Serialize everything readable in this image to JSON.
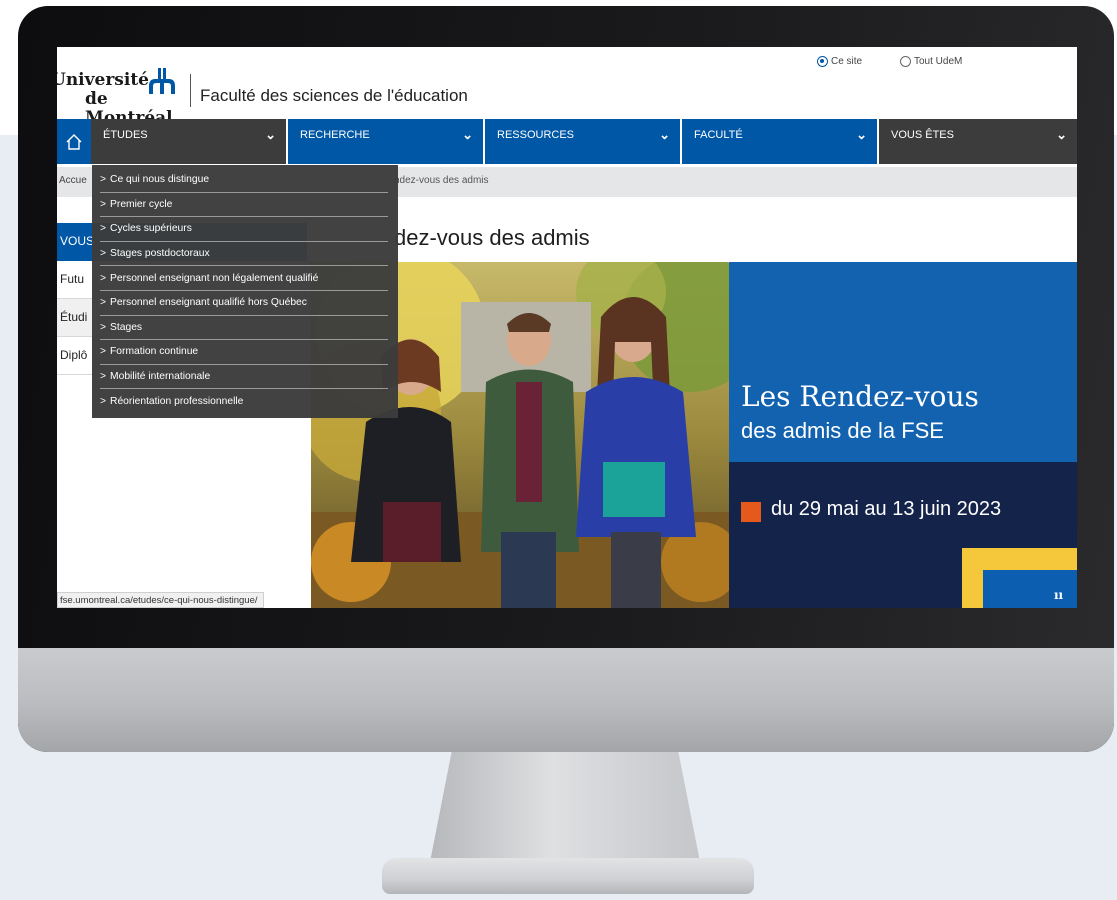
{
  "header": {
    "logo_line1": "Université",
    "logo_line2": "de Montréal",
    "faculty": "Faculté des sciences de l'éducation",
    "scope": {
      "site_label": "Ce site",
      "all_label": "Tout UdeM",
      "selected": "Ce site"
    }
  },
  "nav": {
    "items": [
      {
        "label": "ÉTUDES"
      },
      {
        "label": "RECHERCHE"
      },
      {
        "label": "RESSOURCES"
      },
      {
        "label": "FACULTÉ"
      },
      {
        "label": "VOUS ÊTES"
      }
    ]
  },
  "dropdown": {
    "items": [
      "Ce qui nous distingue",
      "Premier cycle",
      "Cycles supérieurs",
      "Stages postdoctoraux",
      "Personnel enseignant non légalement qualifié",
      "Personnel enseignant qualifié hors Québec",
      "Stages",
      "Formation continue",
      "Mobilité internationale",
      "Réorientation professionnelle"
    ]
  },
  "breadcrumb": {
    "home": "Accue",
    "current": "ndez-vous des admis"
  },
  "left_menu": {
    "header": "VOUS",
    "items": [
      "Futu",
      "Étudi",
      "Diplô"
    ]
  },
  "page": {
    "title": "dez-vous des admis"
  },
  "promo": {
    "title_line1": "Les Rendez-vous",
    "title_line2": "des admis de la FSE",
    "dates": "du 29 mai au 13 juin 2023",
    "corner_mark": "ıı"
  },
  "status_bar": {
    "url": "fse.umontreal.ca/etudes/ce-qui-nous-distingue/"
  },
  "colors": {
    "brand_blue": "#0057a5",
    "nav_dark": "#3c3c3c",
    "promo_navy": "#14234a",
    "accent_orange": "#e55a1c",
    "accent_yellow": "#f5c73a"
  }
}
